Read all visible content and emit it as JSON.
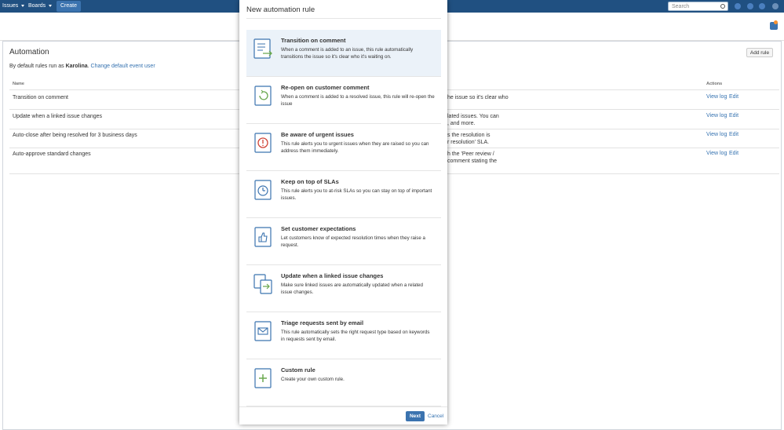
{
  "nav": {
    "issues": "Issues",
    "boards": "Boards",
    "create": "Create",
    "search_placeholder": "Search"
  },
  "page": {
    "title": "Automation",
    "intro_prefix": "By default rules run as",
    "intro_user": "Karolina",
    "intro_period": ".",
    "intro_link": "Change default event user",
    "add_rule": "Add rule",
    "col_name": "Name",
    "col_actions": "Actions"
  },
  "rules": [
    {
      "name": "Transition on comment",
      "desc": [
        "he issue so it's clear who"
      ],
      "view_log": "View log",
      "edit": "Edit"
    },
    {
      "name": "Update when a linked issue changes",
      "desc": [
        "lated issues. You can",
        ", and more."
      ],
      "view_log": "View log",
      "edit": "Edit"
    },
    {
      "name": "Auto-close after being resolved for 3 business days",
      "desc": [
        "s the resolution is",
        "r resolution' SLA."
      ],
      "view_log": "View log",
      "edit": "Edit"
    },
    {
      "name": "Auto-approve standard changes",
      "desc": [
        "h the 'Peer review /",
        "comment stating the"
      ],
      "view_log": "View log",
      "edit": "Edit"
    }
  ],
  "modal": {
    "title": "New automation rule",
    "next": "Next",
    "cancel": "Cancel",
    "templates": [
      {
        "title": "Transition on comment",
        "desc": "When a comment is added to an issue, this rule automatically transitions the issue so it's clear who it's waiting on.",
        "icon": "transition-icon"
      },
      {
        "title": "Re-open on customer comment",
        "desc": "When a comment is added to a resolved issue, this rule will re-open the issue",
        "icon": "reopen-icon"
      },
      {
        "title": "Be aware of urgent issues",
        "desc": "This rule alerts you to urgent issues when they are raised so you can address them immediately.",
        "icon": "alert-icon"
      },
      {
        "title": "Keep on top of SLAs",
        "desc": "This rule alerts you to at-risk SLAs so you can stay on top of important issues.",
        "icon": "stopwatch-icon"
      },
      {
        "title": "Set customer expectations",
        "desc": "Let customers know of expected resolution times when they raise a request.",
        "icon": "thumbs-up-icon"
      },
      {
        "title": "Update when a linked issue changes",
        "desc": "Make sure linked issues are automatically updated when a related issue changes.",
        "icon": "linked-issues-icon"
      },
      {
        "title": "Triage requests sent by email",
        "desc": "This rule automatically sets the right request type based on keywords in requests sent by email.",
        "icon": "email-icon"
      },
      {
        "title": "Custom rule",
        "desc": "Create your own custom rule.",
        "icon": "plus-icon"
      }
    ]
  },
  "colors": {
    "nav_bg": "#205081",
    "accent": "#3b73af",
    "link": "#3572b0",
    "selected_bg": "#ebf2f9"
  }
}
